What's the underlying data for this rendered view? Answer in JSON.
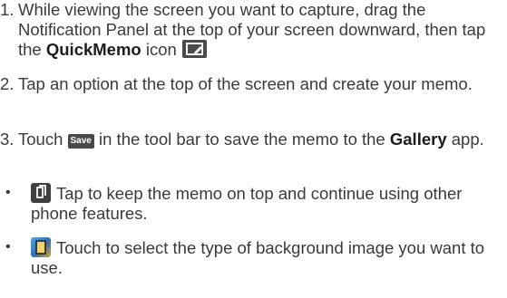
{
  "steps": [
    {
      "number": "1.",
      "text_a": "While viewing the screen you want to capture, drag the Notification Panel at the top of your screen downward, then tap the ",
      "bold": "QuickMemo",
      "text_b": " icon",
      "icon": "quickmemo-icon"
    },
    {
      "number": "2.",
      "text": "Tap an option at the top of the screen and create your memo."
    },
    {
      "number": "3.",
      "text_a": "Touch ",
      "badge": "Save",
      "text_b": " in the tool bar to save the memo to the ",
      "bold": "Gallery",
      "text_c": " app."
    }
  ],
  "bullets": [
    {
      "symbol": "•",
      "icon": "keep-on-top-icon",
      "text": "Tap to keep the memo on top and continue using other phone features."
    },
    {
      "symbol": "•",
      "icon": "background-icon",
      "text": "Touch to select the type of background image you want to use."
    }
  ],
  "colors": {
    "text": "#3a3a3a",
    "icon_dark": "#4a4a4a"
  }
}
